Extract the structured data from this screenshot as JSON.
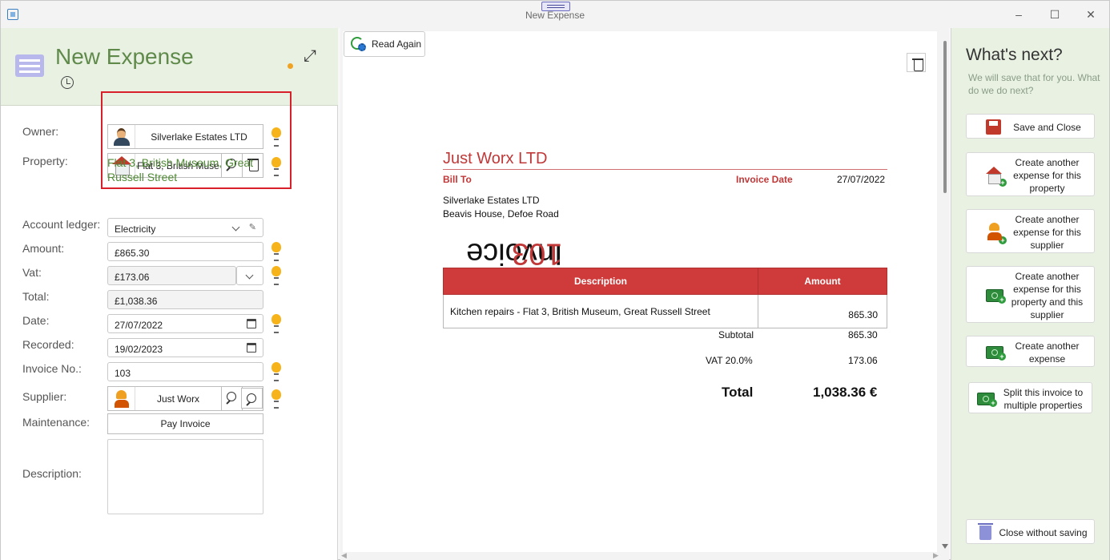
{
  "window": {
    "title": "New Expense"
  },
  "form": {
    "title": "New Expense",
    "labels": {
      "owner": "Owner:",
      "property": "Property:",
      "account_ledger": "Account ledger:",
      "amount": "Amount:",
      "vat": "Vat:",
      "total": "Total:",
      "date": "Date:",
      "recorded": "Recorded:",
      "invoice_no": "Invoice No.:",
      "supplier": "Supplier:",
      "maintenance": "Maintenance:",
      "description": "Description:"
    },
    "owner": "Silverlake Estates LTD",
    "property": "Flat 3, British Muse",
    "property_address": "Flat 3, British Museum, Great Russell Street",
    "account_ledger": "Electricity",
    "amount": "£865.30",
    "vat": "£173.06",
    "total": "£1,038.36",
    "date": "27/07/2022",
    "recorded": "19/02/2023",
    "invoice_no": "103",
    "supplier": "Just Worx",
    "pay_invoice_label": "Pay Invoice",
    "description": ""
  },
  "preview": {
    "read_again_label": "Read Again",
    "invoice_word": "Invoice",
    "invoice_number": "103",
    "company": "Just Worx LTD",
    "bill_to_label": "Bill To",
    "invoice_date_label": "Invoice Date",
    "invoice_date": "27/07/2022",
    "bill_to_name": "Silverlake Estates LTD",
    "bill_to_address": "Beavis House, Defoe Road",
    "table": {
      "headers": [
        "Description",
        "Amount"
      ],
      "rows": [
        {
          "description": "Kitchen repairs - Flat 3, British Museum, Great Russell Street",
          "amount": "865.30"
        }
      ]
    },
    "subtotal_label": "Subtotal",
    "subtotal": "865.30",
    "vat_label": "VAT 20.0%",
    "vat": "173.06",
    "total_label": "Total",
    "total": "1,038.36 €"
  },
  "next": {
    "title": "What's next?",
    "subtitle": "We will save that for you. What do we do next?",
    "actions": [
      "Save and Close",
      "Create another expense for this property",
      "Create another expense for this supplier",
      "Create another expense for this property and this supplier",
      "Create another expense",
      "Split this invoice to multiple properties"
    ],
    "close_without_saving": "Close without saving"
  },
  "colors": {
    "accent_green": "#5f8a4a",
    "invoice_red": "#c03838",
    "panel_green": "#e9f1e3",
    "highlight_red": "#d8202a"
  }
}
